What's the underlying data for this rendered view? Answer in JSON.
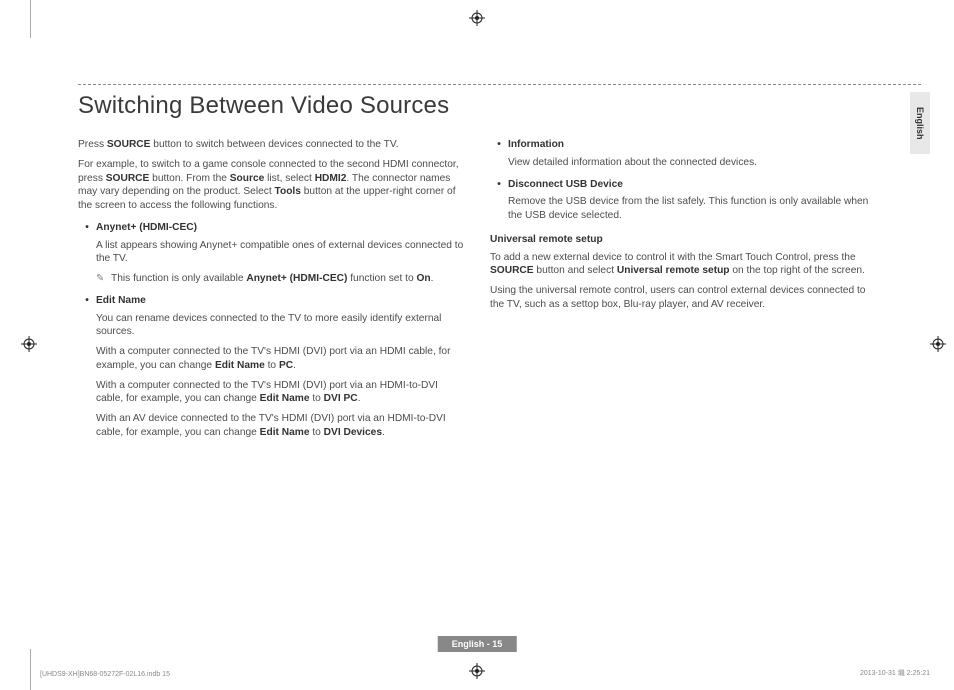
{
  "heading": "Switching Between Video Sources",
  "side_tab": "English",
  "page_badge": "English - 15",
  "footer_left": "[UHDS9-XH]BN68-05272F-02L16.indb   15",
  "footer_right": "2013-10-31   㙨 2:25:21",
  "col1": {
    "p1a": "Press ",
    "p1b": "SOURCE",
    "p1c": " button to switch between devices connected to the TV.",
    "p2a": "For example, to switch to a game console connected to the second HDMI connector, press ",
    "p2b": "SOURCE",
    "p2c": " button. From the ",
    "p2d": "Source",
    "p2e": " list, select ",
    "p2f": "HDMI2",
    "p2g": ". The connector names may vary depending on the product. Select ",
    "p2h": "Tools",
    "p2i": " button at the upper-right corner of the screen to access the following functions.",
    "b1_label": "Anynet+ (HDMI-CEC)",
    "b1_p1": "A list appears showing Anynet+ compatible ones of external devices connected to the TV.",
    "b1_note_a": "This function is only available ",
    "b1_note_b": "Anynet+ (HDMI-CEC)",
    "b1_note_c": " function set to ",
    "b1_note_d": "On",
    "b1_note_e": ".",
    "b2_label": "Edit Name",
    "b2_p1": "You can rename devices connected to the TV to more easily identify external sources.",
    "b2_p2a": "With a computer connected to the TV's HDMI (DVI) port via an HDMI cable, for example, you can change ",
    "b2_p2b": "Edit Name",
    "b2_p2c": " to ",
    "b2_p2d": "PC",
    "b2_p2e": ".",
    "b2_p3a": "With a computer connected to the TV's HDMI (DVI) port via an HDMI-to-DVI cable, for example, you can change ",
    "b2_p3b": "Edit Name",
    "b2_p3c": " to ",
    "b2_p3d": "DVI PC",
    "b2_p3e": ".",
    "b2_p4a": "With an AV device connected to the TV's HDMI (DVI) port via an HDMI-to-DVI cable, for example, you can change ",
    "b2_p4b": "Edit Name",
    "b2_p4c": " to ",
    "b2_p4d": "DVI Devices",
    "b2_p4e": "."
  },
  "col2": {
    "b3_label": "Information",
    "b3_p1": "View detailed information about the connected devices.",
    "b4_label": "Disconnect USB Device",
    "b4_p1": "Remove the USB device from the list safely. This function is only available when the USB device selected.",
    "sub": "Universal remote setup",
    "p1a": "To add a new external device to control it with the Smart Touch Control, press the ",
    "p1b": "SOURCE",
    "p1c": " button and select ",
    "p1d": "Universal remote setup",
    "p1e": " on the top right of the screen.",
    "p2": "Using the universal remote control, users can control external devices connected to the TV, such as a settop box, Blu-ray player, and AV receiver."
  }
}
